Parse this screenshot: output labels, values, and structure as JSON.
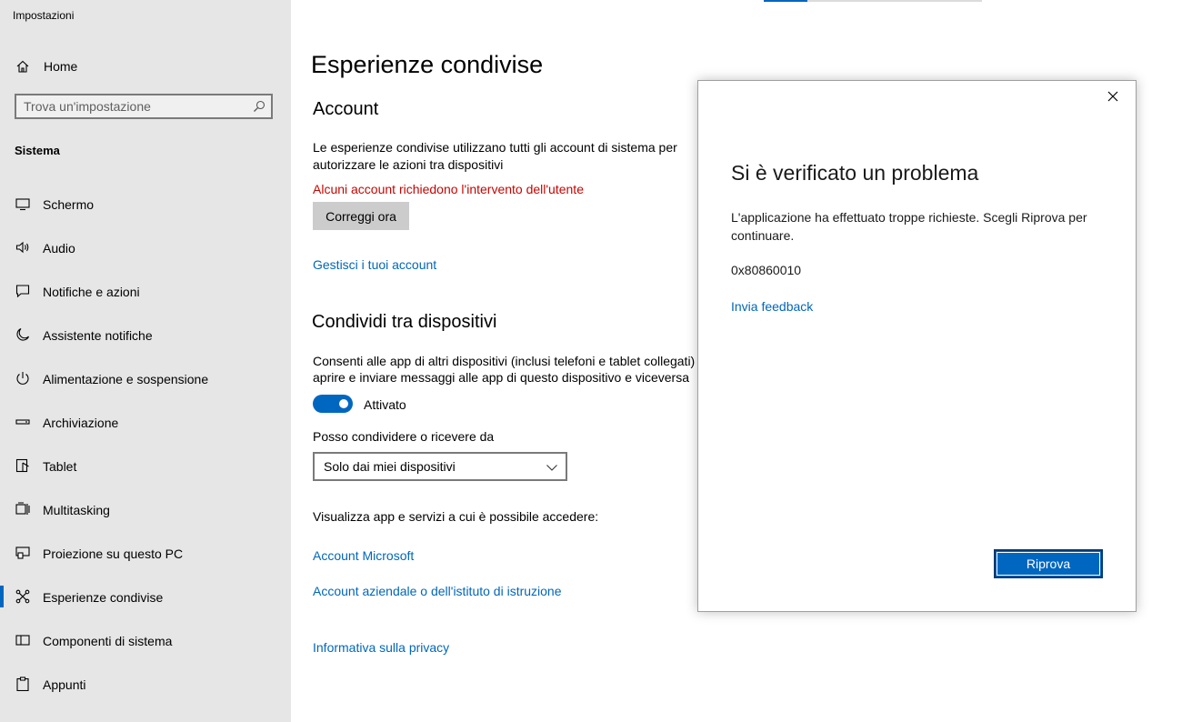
{
  "app": {
    "title": "Impostazioni"
  },
  "sidebar": {
    "home_label": "Home",
    "search_placeholder": "Trova un'impostazione",
    "section_label": "Sistema",
    "items": [
      {
        "label": "Schermo",
        "icon": "monitor-icon"
      },
      {
        "label": "Audio",
        "icon": "speaker-icon"
      },
      {
        "label": "Notifiche e azioni",
        "icon": "notification-icon"
      },
      {
        "label": "Assistente notifiche",
        "icon": "moon-icon"
      },
      {
        "label": "Alimentazione e sospensione",
        "icon": "power-icon"
      },
      {
        "label": "Archiviazione",
        "icon": "storage-icon"
      },
      {
        "label": "Tablet",
        "icon": "tablet-icon"
      },
      {
        "label": "Multitasking",
        "icon": "multitasking-icon"
      },
      {
        "label": "Proiezione su questo PC",
        "icon": "projection-icon"
      },
      {
        "label": "Esperienze condivise",
        "icon": "shared-icon",
        "active": true
      },
      {
        "label": "Componenti di sistema",
        "icon": "components-icon"
      },
      {
        "label": "Appunti",
        "icon": "clipboard-icon"
      }
    ]
  },
  "main": {
    "title": "Esperienze condivise",
    "account": {
      "heading": "Account",
      "description_line1": "Le esperienze condivise utilizzano tutti gli account di sistema per",
      "description_line2": "autorizzare le azioni tra dispositivi",
      "warning": "Alcuni account richiedono l'intervento dell'utente",
      "fix_button": "Correggi ora",
      "manage_link": "Gestisci i tuoi account"
    },
    "share": {
      "heading": "Condividi tra dispositivi",
      "description_line1": "Consenti alle app di altri dispositivi (inclusi telefoni e tablet collegati) di",
      "description_line2": "aprire e inviare messaggi alle app di questo dispositivo e viceversa",
      "toggle_state": "Attivato",
      "toggle_on": true,
      "select_label": "Posso condividere o ricevere da",
      "select_value": "Solo dai miei dispositivi"
    },
    "apps": {
      "label": "Visualizza app e servizi a cui è possibile accedere:",
      "link1": "Account Microsoft",
      "link2": "Account aziendale o dell'istituto di istruzione"
    },
    "privacy_link": "Informativa sulla privacy"
  },
  "dialog": {
    "title": "Si è verificato un problema",
    "message": "L'applicazione ha effettuato troppe richieste. Scegli Riprova per continuare.",
    "code": "0x80860010",
    "feedback_link": "Invia feedback",
    "retry_button": "Riprova"
  },
  "colors": {
    "accent": "#0067c0",
    "link": "#0067b8",
    "warning": "#c50500",
    "sidebar_bg": "#e6e6e6"
  }
}
